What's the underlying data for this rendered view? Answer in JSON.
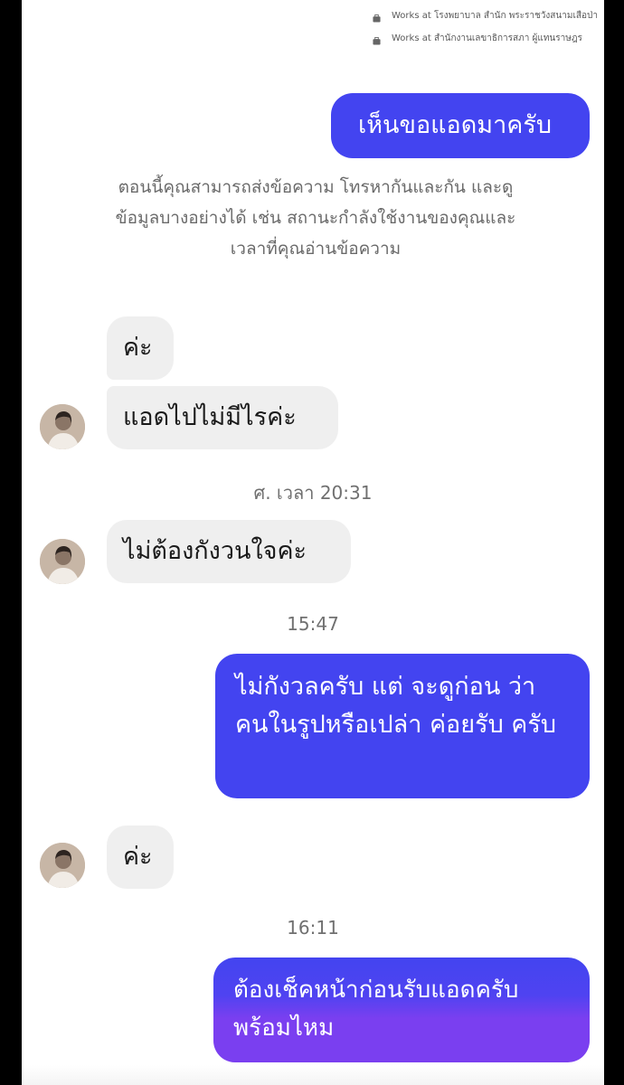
{
  "profile": {
    "work_lines": [
      "Works at โรงพยาบาล สำนัก พระราชวังสนามเสือป่า",
      "Works at สำนักงานเลขาธิการสภา ผู้แทนราษฎร"
    ]
  },
  "system_note": "ตอนนี้คุณสามารถส่งข้อความ โทรหากันและกัน และดูข้อมูลบางอย่างได้ เช่น สถานะกำลังใช้งานของคุณและเวลาที่คุณอ่านข้อความ",
  "messages": [
    {
      "text": "เห็นขอแอดมาครับ",
      "direction": "outgoing"
    },
    {
      "text": "ค่ะ",
      "direction": "incoming"
    },
    {
      "text": "แอดไปไม่มีไรค่ะ",
      "direction": "incoming"
    },
    {
      "text": "ไม่ต้องกังวนใจค่ะ",
      "direction": "incoming"
    },
    {
      "text": "ไม่กังวลครับ แต่ จะดูก่อน ว่า คนในรูปหรือเปล่า ค่อยรับ ครับ",
      "direction": "outgoing"
    },
    {
      "text": "ค่ะ",
      "direction": "incoming"
    },
    {
      "text": "ต้องเช็คหน้าก่อนรับแอดครับ พร้อมไหม",
      "direction": "outgoing"
    }
  ],
  "timestamps": [
    "ศ. เวลา 20:31",
    "15:47",
    "16:11"
  ],
  "colors": {
    "outgoing_bubble": "#4344f0",
    "outgoing_bubble_end": "#7a3ff0",
    "incoming_bubble": "#efefef",
    "background": "#ffffff",
    "letterbox": "#000000"
  },
  "icons": {
    "work": "briefcase-icon",
    "avatar": "contact-avatar"
  }
}
